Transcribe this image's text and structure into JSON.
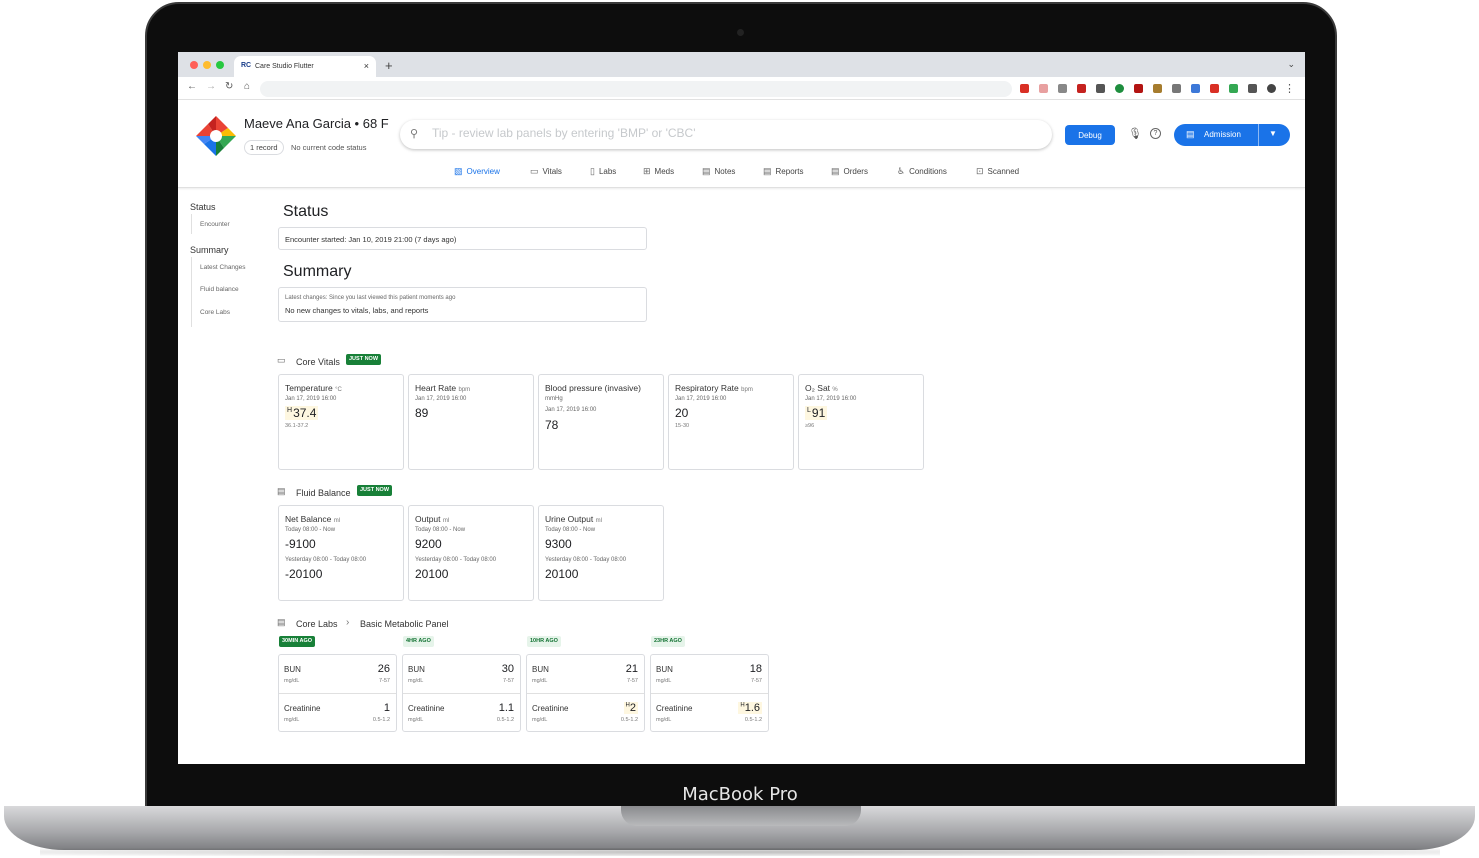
{
  "device": {
    "label": "MacBook Pro"
  },
  "browser": {
    "tab_title": "Care Studio Flutter",
    "tab_favicon": "RC",
    "new_tab": "+",
    "close_tab": "×"
  },
  "app": {
    "patient": {
      "name": "Maeve Ana Garcia • 68 F",
      "record_chip": "1 record",
      "code_status": "No current code status"
    },
    "search": {
      "placeholder": "Tip - review lab panels by entering 'BMP' or 'CBC'"
    },
    "debug_label": "Debug",
    "admission_label": "Admission",
    "tabs": [
      {
        "label": "Overview",
        "icon": "overview-icon"
      },
      {
        "label": "Vitals",
        "icon": "vitals-icon"
      },
      {
        "label": "Labs",
        "icon": "labs-icon"
      },
      {
        "label": "Meds",
        "icon": "meds-icon"
      },
      {
        "label": "Notes",
        "icon": "notes-icon"
      },
      {
        "label": "Reports",
        "icon": "reports-icon"
      },
      {
        "label": "Orders",
        "icon": "orders-icon"
      },
      {
        "label": "Conditions",
        "icon": "conditions-icon"
      },
      {
        "label": "Scanned",
        "icon": "scanned-icon"
      }
    ],
    "active_tab": "Overview"
  },
  "leftnav": {
    "status_header": "Status",
    "status_items": [
      "Encounter"
    ],
    "summary_header": "Summary",
    "summary_items": [
      "Latest Changes",
      "Fluid balance",
      "Core Labs"
    ]
  },
  "status": {
    "title": "Status",
    "encounter": "Encounter started: Jan 10, 2019 21:00 (7 days ago)"
  },
  "summary": {
    "title": "Summary",
    "latest_changes_label": "Latest changes: Since you last viewed this patient moments ago",
    "latest_changes_text": "No new changes to vitals, labs, and reports"
  },
  "core_vitals": {
    "title": "Core Vitals",
    "badge": "JUST NOW",
    "cards": [
      {
        "name": "Temperature",
        "unit": "°C",
        "date": "Jan 17, 2019 16:00",
        "flag": "H",
        "value": "37.4",
        "range": "36.1-37.2"
      },
      {
        "name": "Heart Rate",
        "unit": "bpm",
        "date": "Jan 17, 2019 16:00",
        "flag": "",
        "value": "89",
        "range": ""
      },
      {
        "name": "Blood pressure (invasive)",
        "unit": "mmHg",
        "date": "Jan 17, 2019 16:00",
        "flag": "",
        "value": "78",
        "range": ""
      },
      {
        "name": "Respiratory Rate",
        "unit": "bpm",
        "date": "Jan 17, 2019 16:00",
        "flag": "",
        "value": "20",
        "range": "15-30"
      },
      {
        "name": "O₂ Sat",
        "unit": "%",
        "date": "Jan 17, 2019 16:00",
        "flag": "L",
        "value": "91",
        "range": "≥96"
      }
    ]
  },
  "fluid_balance": {
    "title": "Fluid Balance",
    "badge": "JUST NOW",
    "cards": [
      {
        "name": "Net Balance",
        "unit": "ml",
        "period1": "Today 08:00 - Now",
        "value1": "-9100",
        "period2": "Yesterday 08:00 - Today 08:00",
        "value2": "-20100"
      },
      {
        "name": "Output",
        "unit": "ml",
        "period1": "Today 08:00 - Now",
        "value1": "9200",
        "period2": "Yesterday 08:00 - Today 08:00",
        "value2": "20100"
      },
      {
        "name": "Urine Output",
        "unit": "ml",
        "period1": "Today 08:00 - Now",
        "value1": "9300",
        "period2": "Yesterday 08:00 - Today 08:00",
        "value2": "20100"
      }
    ]
  },
  "core_labs": {
    "title": "Core Labs",
    "breadcrumb_sep": "›",
    "panel": "Basic Metabolic Panel",
    "columns": [
      {
        "badge": "30MIN AGO",
        "badge_style": "dark",
        "bun": "26",
        "bun_range": "7-57",
        "creat": "1",
        "creat_flag": "",
        "creat_range": "0.5-1.2"
      },
      {
        "badge": "4HR AGO",
        "badge_style": "light",
        "bun": "30",
        "bun_range": "7-57",
        "creat": "1.1",
        "creat_flag": "",
        "creat_range": "0.5-1.2"
      },
      {
        "badge": "10HR AGO",
        "badge_style": "light",
        "bun": "21",
        "bun_range": "7-57",
        "creat": "2",
        "creat_flag": "H",
        "creat_range": "0.5-1.2"
      },
      {
        "badge": "23HR AGO",
        "badge_style": "light",
        "bun": "18",
        "bun_range": "7-57",
        "creat": "1.6",
        "creat_flag": "H",
        "creat_range": "0.5-1.2"
      }
    ],
    "bun_label": "BUN",
    "creat_label": "Creatinine",
    "unit": "mg/dL"
  }
}
